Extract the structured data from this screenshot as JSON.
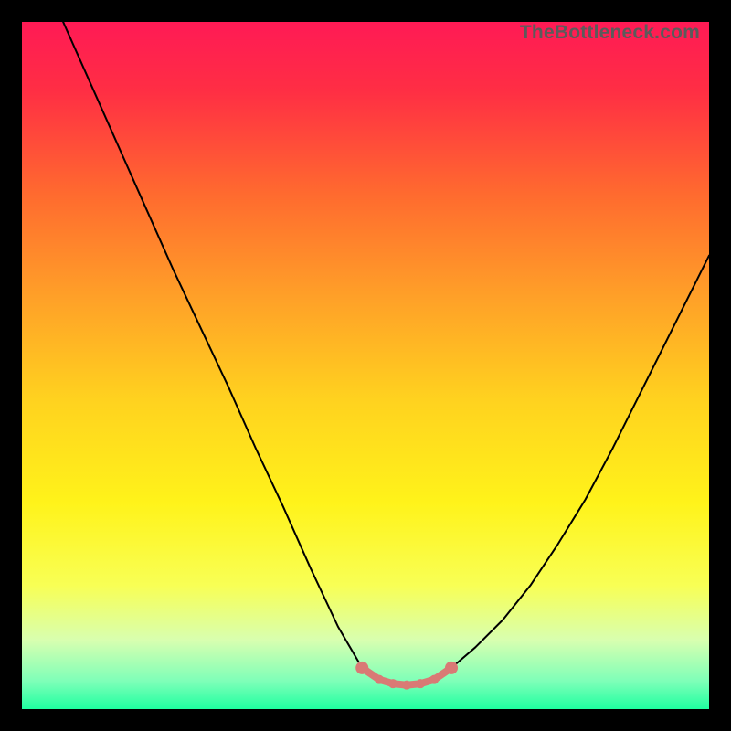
{
  "watermark": {
    "text": "TheBottleneck.com"
  },
  "colors": {
    "frame": "#000000",
    "curve": "#000000",
    "marker_fill": "#d97a75",
    "marker_stroke": "#d97a75",
    "gradient_stops": [
      {
        "offset": 0.0,
        "color": "#ff1a55"
      },
      {
        "offset": 0.1,
        "color": "#ff2e44"
      },
      {
        "offset": 0.25,
        "color": "#ff6a2f"
      },
      {
        "offset": 0.4,
        "color": "#ffa028"
      },
      {
        "offset": 0.55,
        "color": "#ffd21f"
      },
      {
        "offset": 0.7,
        "color": "#fff31a"
      },
      {
        "offset": 0.82,
        "color": "#f8ff55"
      },
      {
        "offset": 0.9,
        "color": "#d8ffb0"
      },
      {
        "offset": 0.96,
        "color": "#7dffb8"
      },
      {
        "offset": 1.0,
        "color": "#1fffa0"
      }
    ]
  },
  "chart_data": {
    "type": "line",
    "title": "",
    "xlabel": "",
    "ylabel": "",
    "xlim": [
      0,
      100
    ],
    "ylim": [
      0,
      100
    ],
    "series": [
      {
        "name": "left-curve",
        "x": [
          6,
          10,
          14,
          18,
          22,
          26,
          30,
          34,
          38,
          42,
          46,
          49.5
        ],
        "y": [
          100,
          91,
          82,
          73,
          64,
          55.5,
          47,
          38,
          29.5,
          20.5,
          12,
          6
        ]
      },
      {
        "name": "right-curve",
        "x": [
          62.5,
          66,
          70,
          74,
          78,
          82,
          86,
          90,
          94,
          98,
          100
        ],
        "y": [
          6,
          9,
          13,
          18,
          24,
          30.5,
          38,
          46,
          54,
          62,
          66
        ]
      },
      {
        "name": "flat-bottom",
        "x": [
          49.5,
          52,
          54,
          56,
          58,
          60,
          62.5
        ],
        "y": [
          6,
          4.3,
          3.7,
          3.5,
          3.7,
          4.3,
          6
        ]
      }
    ],
    "markers": {
      "name": "bottom-markers",
      "x": [
        49.5,
        52,
        54,
        56,
        58,
        60,
        62.5
      ],
      "y": [
        6,
        4.3,
        3.7,
        3.5,
        3.7,
        4.3,
        6
      ]
    }
  }
}
